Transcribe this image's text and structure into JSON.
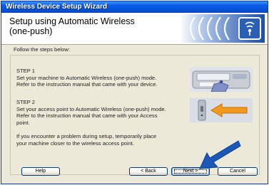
{
  "window": {
    "title": "Wireless Device Setup Wizard"
  },
  "header": {
    "title": "Setup using Automatic Wireless\n(one-push)",
    "logo_icon": "wireless-signal-icon"
  },
  "content": {
    "instruction": "Follow the steps below:",
    "steps": [
      {
        "text": "STEP 1\nSet your machine to Automatic Wireless (one-push) mode.\nRefer to the instruction manual that came with your device.",
        "image_icon": "printer-button-press-icon"
      },
      {
        "text": "STEP 2\nSet your access point to Automatic Wireless (one-push) mode.\nRefer to the instruction manual that came with your Access\npoint.",
        "image_icon": "access-point-arrow-icon"
      }
    ],
    "trouble_text": "If you encounter a problem during setup, temporarily place\nyour machine closer to the wireless access point."
  },
  "buttons": {
    "help": "Help",
    "back": "< Back",
    "next": "Next >",
    "cancel": "Cancel"
  },
  "colors": {
    "titlebar": "#0a5ce6",
    "accent_blue": "#1c58b8",
    "arrow_orange": "#f39a1e"
  }
}
